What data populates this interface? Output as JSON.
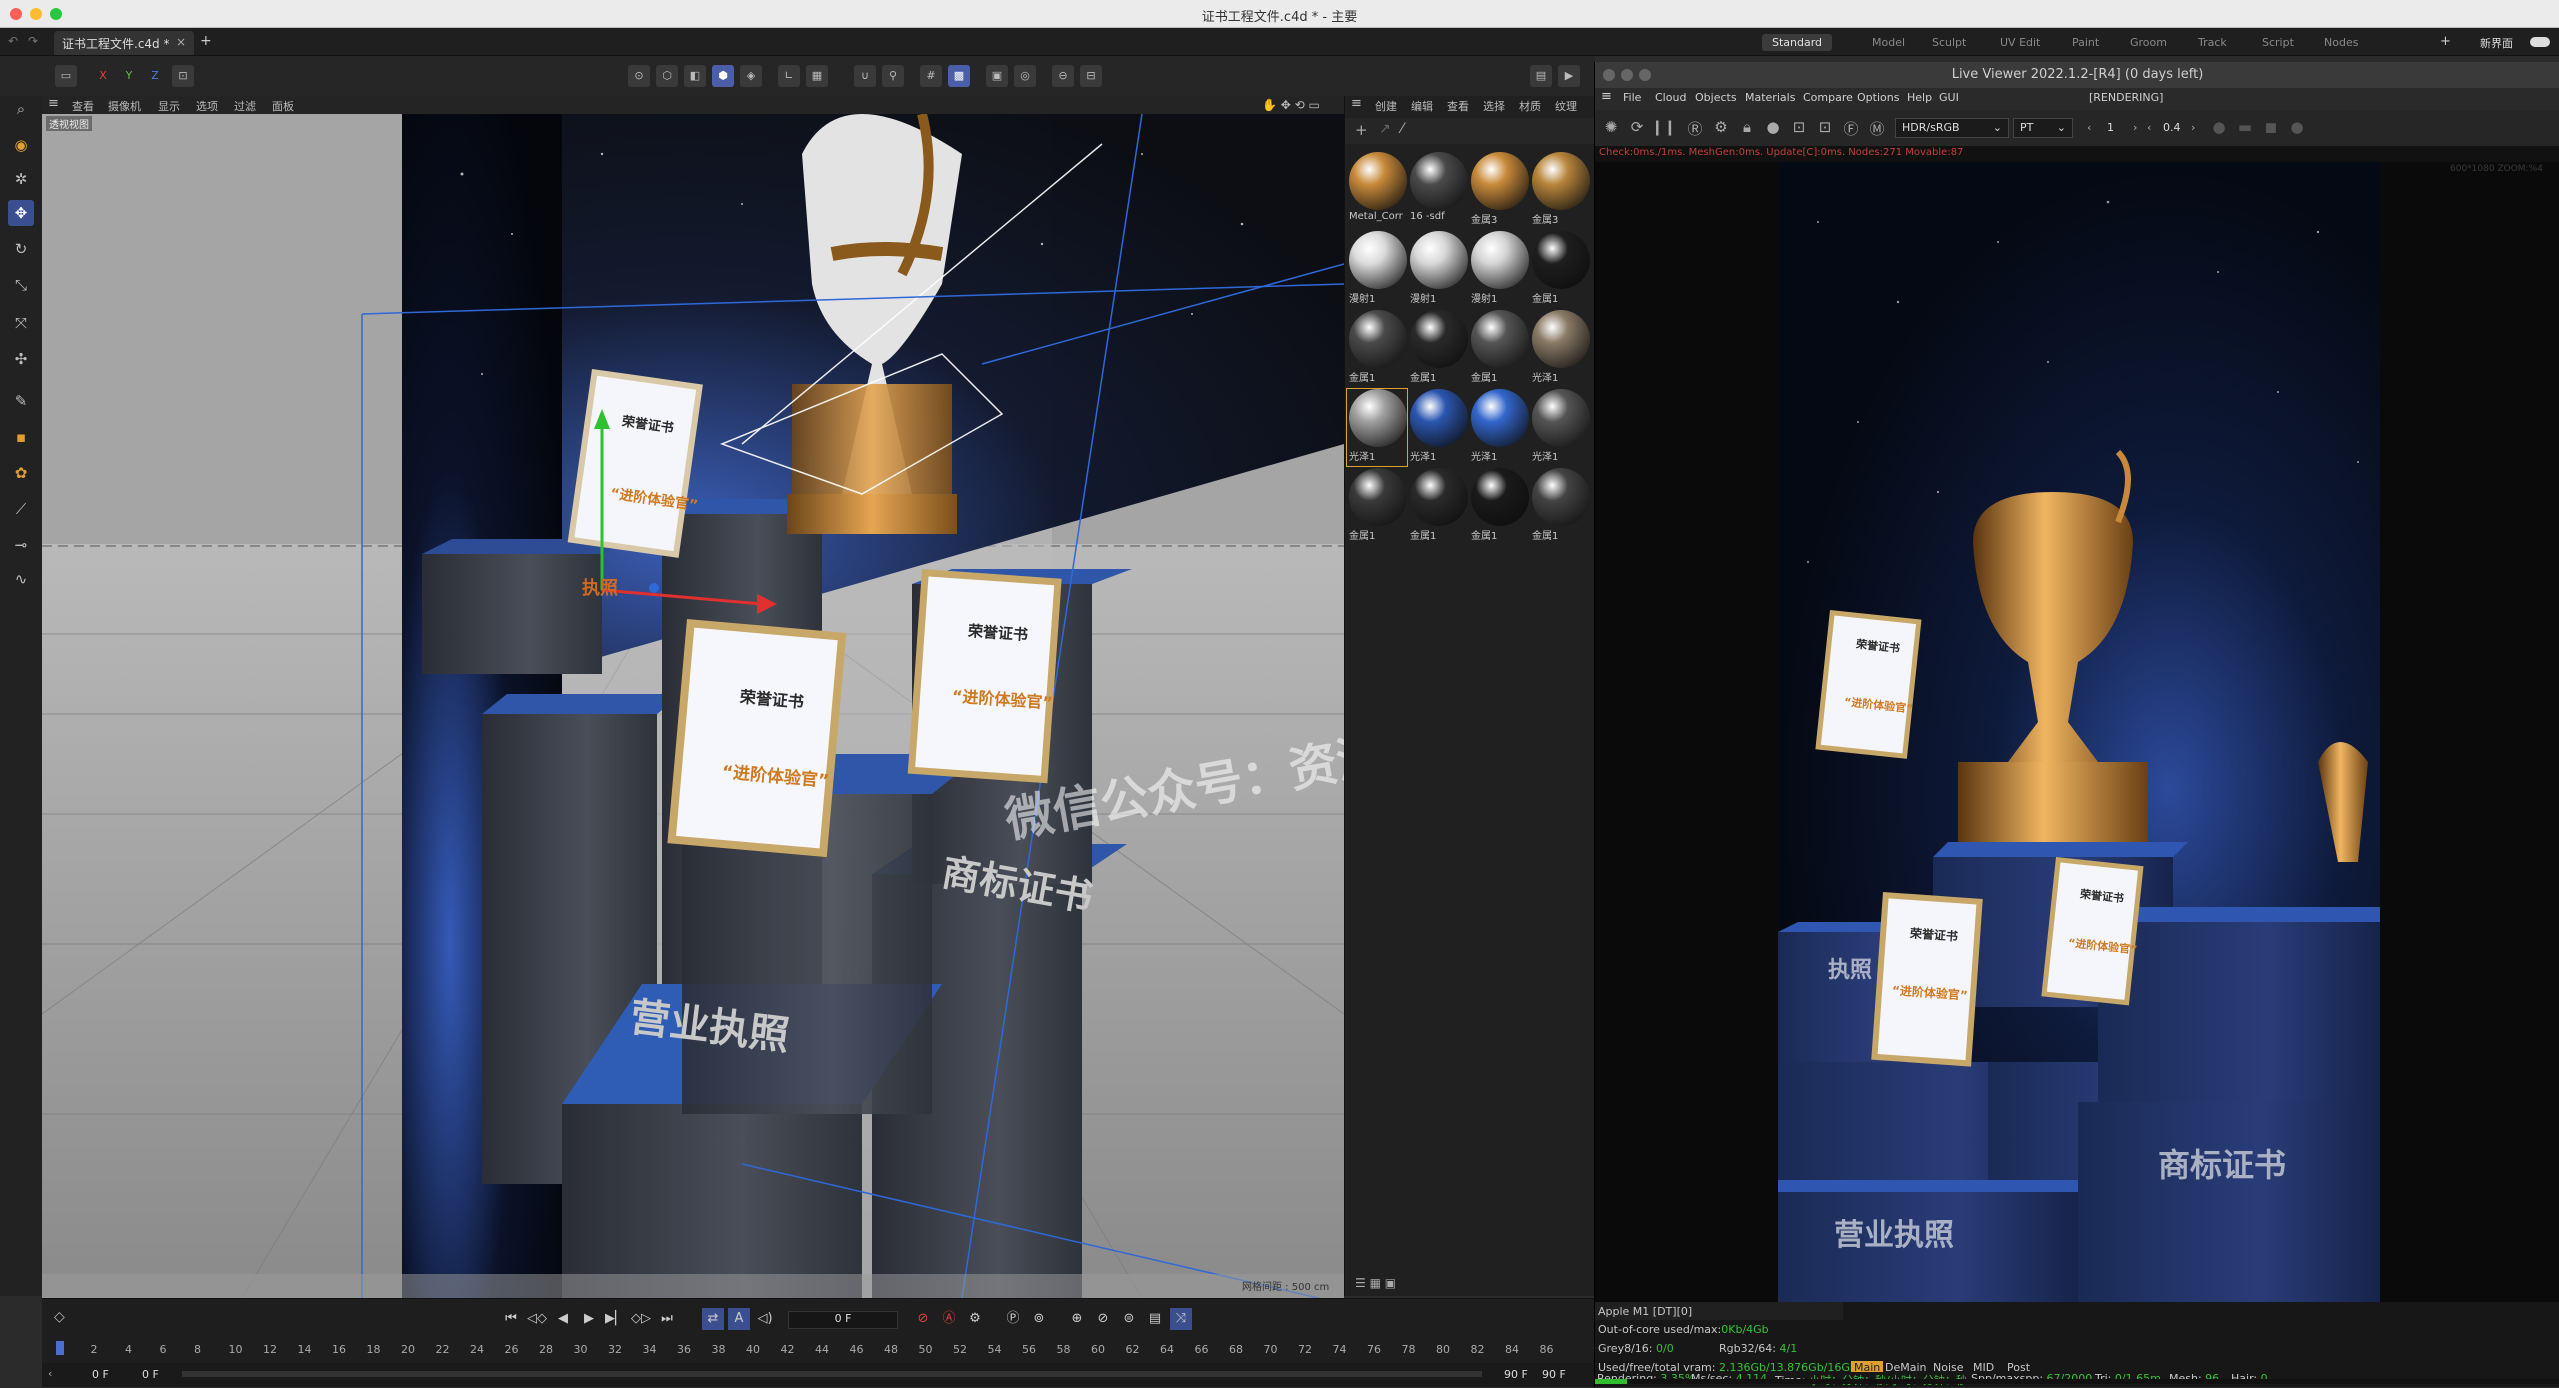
{
  "titlebar": {
    "title": "证书工程文件.c4d * - 主要"
  },
  "tabs": {
    "doc_tab": "证书工程文件.c4d *",
    "close": "×",
    "plus": "+"
  },
  "layouts": {
    "items": [
      "Standard",
      "Model",
      "Sculpt",
      "UV Edit",
      "Paint",
      "Groom",
      "Track",
      "Script",
      "Nodes"
    ],
    "new_ui": "新界面",
    "plus": "+"
  },
  "toolbar": {
    "x": "X",
    "y": "Y",
    "z": "Z"
  },
  "viewport_menu": {
    "items": [
      "查看",
      "摄像机",
      "显示",
      "选项",
      "过滤",
      "面板"
    ],
    "view_label": "透视视图",
    "grid_label": "网格间距 : 500 cm"
  },
  "viewport_scene": {
    "cert_title": "荣誉证书",
    "cert_sub": "“进阶体验官”",
    "ped_label_front": "营业执照",
    "ped_label_right": "商标证书",
    "ped_label_left": "执照",
    "watermark": "微信公众号：资源设"
  },
  "materials": {
    "menu": [
      "创建",
      "编辑",
      "查看",
      "选择",
      "材质",
      "纹理"
    ],
    "items": [
      {
        "name": "Metal_Corr",
        "color": "#c88a3a"
      },
      {
        "name": "16 -sdf",
        "color": "#4a4a4a"
      },
      {
        "name": "金属3",
        "color": "#c88a3a"
      },
      {
        "name": "金属3",
        "color": "#b8853c"
      },
      {
        "name": "漫射1",
        "color": "#dcdcdc"
      },
      {
        "name": "漫射1",
        "color": "#d8d8d8"
      },
      {
        "name": "漫射1",
        "color": "#d4d4d4"
      },
      {
        "name": "金属1",
        "color": "#1e1e1e"
      },
      {
        "name": "金属1",
        "color": "#4a4a4a"
      },
      {
        "name": "金属1",
        "color": "#2a2a2a"
      },
      {
        "name": "金属1",
        "color": "#555"
      },
      {
        "name": "光泽1",
        "color": "#8a7a66"
      },
      {
        "name": "光泽1",
        "color": "#a0a0a0"
      },
      {
        "name": "光泽1",
        "color": "#2b56b0"
      },
      {
        "name": "光泽1",
        "color": "#3366cc"
      },
      {
        "name": "光泽1",
        "color": "#555"
      },
      {
        "name": "金属1",
        "color": "#3a3a3a"
      },
      {
        "name": "金属1",
        "color": "#2a2a2a"
      },
      {
        "name": "金属1",
        "color": "#1a1a1a"
      },
      {
        "name": "金属1",
        "color": "#444"
      }
    ]
  },
  "live_viewer": {
    "title": "Live Viewer 2022.1.2-[R4] (0 days left)",
    "menu": [
      "File",
      "Cloud",
      "Objects",
      "Materials",
      "Compare",
      "Options",
      "Help",
      "GUI"
    ],
    "rendering_tag": "[RENDERING]",
    "colorspace": "HDR/sRGB",
    "kernel": "PT",
    "value1": "1",
    "value2": "0.4",
    "status": "Check:0ms./1ms. MeshGen:0ms. Update[C]:0ms. Nodes:271 Movable:87",
    "zoom": "600*1080 ZOOM:%4",
    "render_scene": {
      "cert_title": "荣誉证书",
      "cert_sub": "“进阶体验官”",
      "ped_label_left": "执照",
      "ped_label_front": "营业执照",
      "ped_label_right": "商标证书"
    },
    "footer": {
      "device": "Apple M1 [DT][0]",
      "oc_label": "Out-of-core used/max:",
      "oc_value": "0Kb/4Gb",
      "grey_label": "Grey8/16:",
      "grey_value": "0/0",
      "rgb_label": "Rgb32/64:",
      "rgb_value": "4/1",
      "vram_label": "Used/free/total vram:",
      "vram_value": "2.136Gb/13.876Gb/16Gb",
      "tabs": [
        "Main",
        "DeMain",
        "Noise",
        "MID",
        "Post"
      ],
      "rendering_label": "Rendering:",
      "rendering_value": "3.35%",
      "ms_label": "Ms/sec:",
      "ms_value": "4.114",
      "time_label": "Time:",
      "time_value": "小时：分钟：秒/小时：分钟：秒",
      "spp_label": "Spp/maxspp:",
      "spp_value": "67/2000",
      "tri_label": "Tri:",
      "tri_value": "0/1.65m",
      "mesh_label": "Mesh:",
      "mesh_value": "96",
      "hair_label": "Hair:",
      "hair_value": "0",
      "progress": 0.0335
    }
  },
  "timeline": {
    "frame_field": "0 F",
    "ticks": [
      "0",
      "2",
      "4",
      "6",
      "8",
      "10",
      "12",
      "14",
      "16",
      "18",
      "20",
      "22",
      "24",
      "26",
      "28",
      "30",
      "32",
      "34",
      "36",
      "38",
      "40",
      "42",
      "44",
      "46",
      "48",
      "50",
      "52",
      "54",
      "56",
      "58",
      "60",
      "62",
      "64",
      "66",
      "68",
      "70",
      "72",
      "74",
      "76",
      "78",
      "80",
      "82",
      "84",
      "86"
    ],
    "start": "0 F",
    "start2": "0 F",
    "end": "90 F",
    "end2": "90 F"
  }
}
